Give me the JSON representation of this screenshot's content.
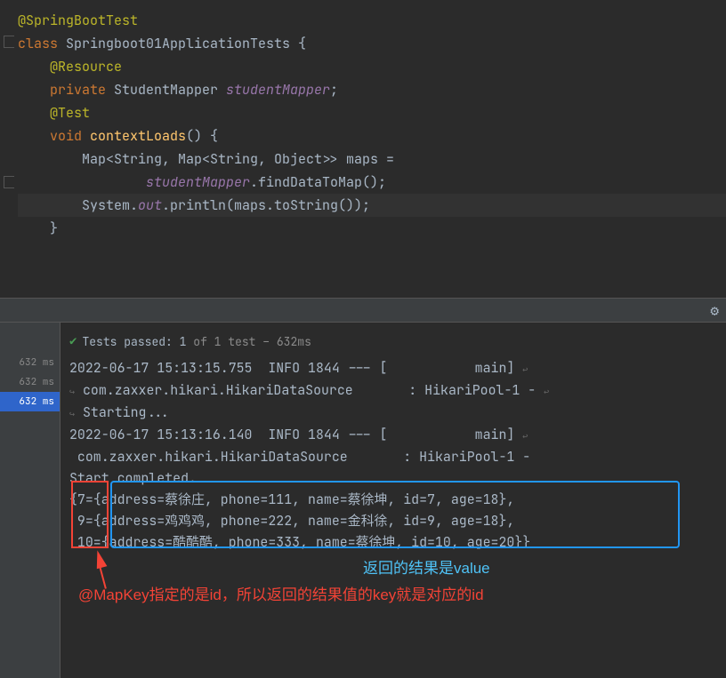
{
  "code": {
    "l1_annotation": "@SpringBootTest",
    "l2_keyword": "class ",
    "l2_classname": "Springboot01ApplicationTests {",
    "l3_annotation": "    @Resource",
    "l4_keyword": "    private ",
    "l4_type": "StudentMapper ",
    "l4_field": "studentMapper",
    "l4_semi": ";",
    "l5": "",
    "l6_annotation": "    @Test",
    "l7_keyword": "    void ",
    "l7_method": "contextLoads",
    "l7_rest": "() {",
    "l8_text": "        Map<String, Map<String, Object>> maps =",
    "l9_pre": "                ",
    "l9_field": "studentMapper",
    "l9_dot": ".findDataToMap();",
    "l10_pre": "        System.",
    "l10_out": "out",
    "l10_rest": ".println(maps.toString());",
    "l11": "    }"
  },
  "test_status": {
    "label_prefix": "Tests passed:",
    "count": "1",
    "of_text": "of 1 test – 632ms"
  },
  "timings": {
    "t1": "632 ms",
    "t2": "632 ms",
    "t3": "632 ms"
  },
  "log": {
    "l1": "2022-06-17 15:13:15.755  INFO 1844 --- [           main] ",
    "l2": " com.zaxxer.hikari.HikariDataSource       : HikariPool-1 - ",
    "l3": " Starting...",
    "l4": "2022-06-17 15:13:16.140  INFO 1844 --- [           main] ",
    "l5": " com.zaxxer.hikari.HikariDataSource       : HikariPool-1 - ",
    "l6": "Start completed.",
    "l7": "{7={address=蔡徐庄, phone=111, name=蔡徐坤, id=7, age=18}, ",
    "l8": " 9={address=鸡鸡鸡, phone=222, name=金科徐, id=9, age=18}, ",
    "l9": " 10={address=酷酷酷, phone=333, name=蔡徐坤, id=10, age=20}}"
  },
  "annotations": {
    "blue": "返回的结果是value",
    "red": "@MapKey指定的是id，所以返回的结果值的key就是对应的id"
  }
}
